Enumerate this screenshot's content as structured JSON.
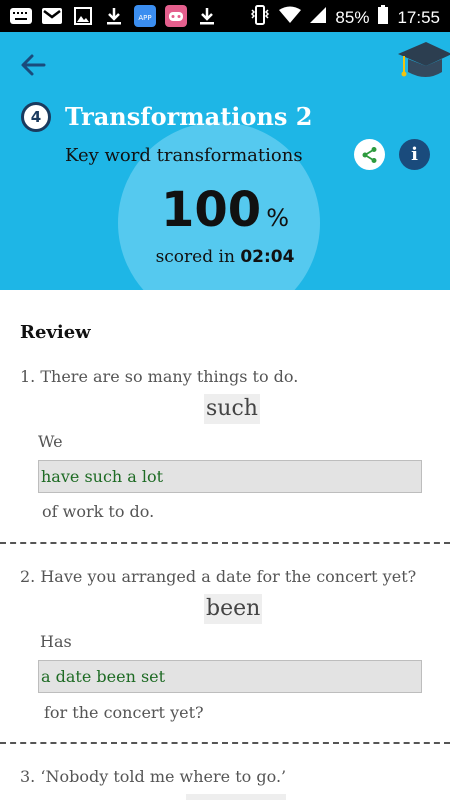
{
  "status_bar": {
    "left_icons": [
      "keyboard-icon",
      "gmail-icon",
      "image-icon",
      "download-icon",
      "app-store-icon",
      "game-icon",
      "download-icon"
    ],
    "battery": "85%",
    "time": "17:55"
  },
  "header": {
    "background": "#1eb6e6",
    "unit_number": "4",
    "title": "Transformations 2",
    "subtitle": "Key word transformations",
    "score_value": "100",
    "score_unit": "%",
    "scored_prefix": "scored in",
    "scored_time": "02:04"
  },
  "review": {
    "heading": "Review",
    "questions": [
      {
        "prompt": "1. There are so many things to do.",
        "keyword": "such",
        "prefix": "We",
        "answer": "have such a lot",
        "suffix": "of work to do."
      },
      {
        "prompt": "2. Have you arranged a date for the concert yet?",
        "keyword": "been",
        "prefix": "Has",
        "answer": "a date been set",
        "suffix": "for the concert yet?"
      },
      {
        "prompt": "3. ‘Nobody told me where to go.’"
      }
    ]
  }
}
